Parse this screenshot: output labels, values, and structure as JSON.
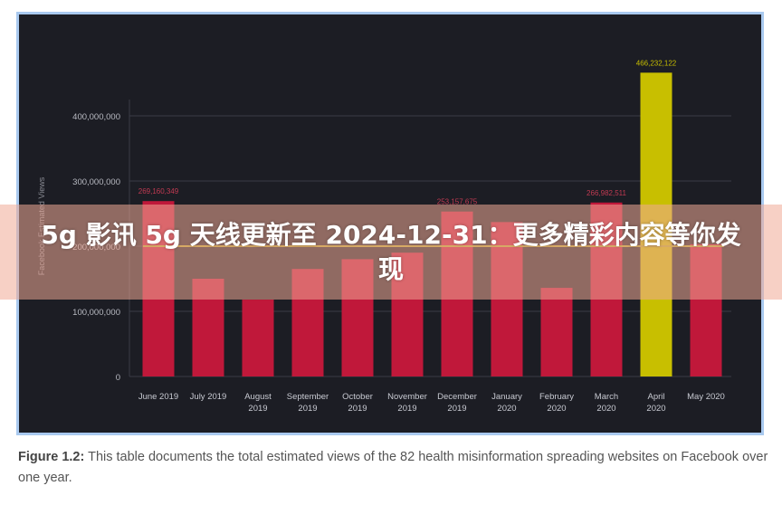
{
  "chart_data": {
    "type": "bar",
    "ylabel": "Facebook Estimated Views",
    "ylim": [
      0,
      466232122
    ],
    "yticks": [
      "0",
      "100,000,000",
      "200,000,000",
      "300,000,000",
      "400,000,000"
    ],
    "ytick_values": [
      0,
      100000000,
      200000000,
      300000000,
      400000000
    ],
    "grid": true,
    "categories": [
      "June 2019",
      "July 2019",
      "August 2019",
      "September 2019",
      "October 2019",
      "November 2019",
      "December 2019",
      "January 2020",
      "February 2020",
      "March 2020",
      "April 2020",
      "May 2020"
    ],
    "values": [
      269160349,
      150000000,
      118000000,
      165000000,
      180000000,
      190000000,
      253157675,
      237000000,
      136000000,
      266982511,
      466232122,
      203000000
    ],
    "labels": [
      "269,160,349",
      "",
      "",
      "",
      "",
      "",
      "253,157,675",
      "",
      "",
      "266,982,511",
      "466,232,122",
      ""
    ],
    "reference_line": 200000000,
    "colors": {
      "bar": "#c0183a",
      "highlight": "#c8bf00",
      "line": "#b5a92a",
      "background": "#1c1d24"
    },
    "highlight_index": 10
  },
  "caption": {
    "label": "Figure 1.2:",
    "text": " This table documents the total estimated views of the 82 health misinformation spreading websites on Facebook over one year."
  },
  "banner": {
    "text": "5g 影讯 5g 天线更新至 2024-12-31：更多精彩内容等你发现"
  }
}
